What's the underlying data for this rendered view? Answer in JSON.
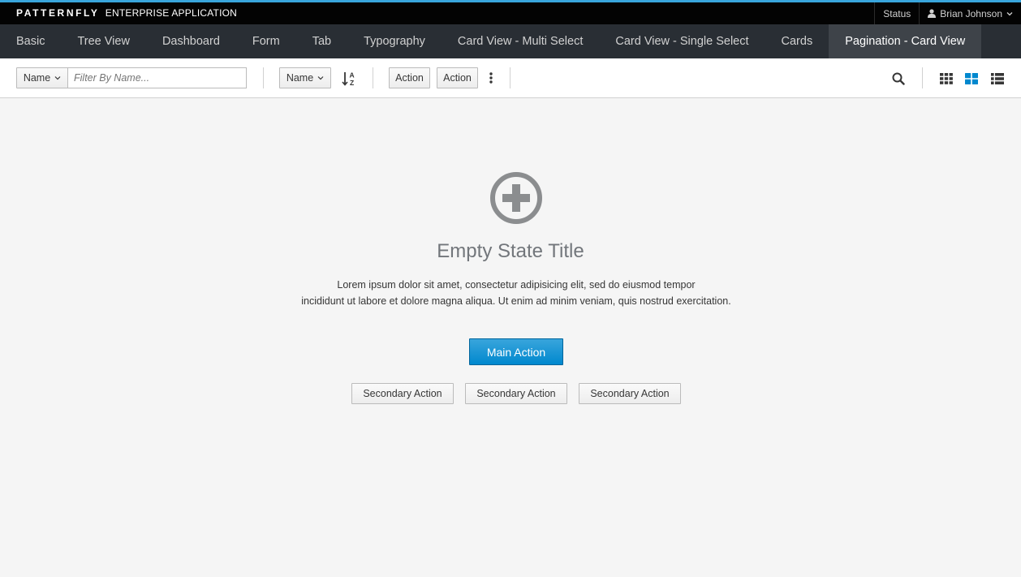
{
  "masthead": {
    "brand_logo": "PATTERNFLY",
    "brand_app": "ENTERPRISE APPLICATION",
    "status_label": "Status",
    "user_name": "Brian Johnson"
  },
  "nav": {
    "items": [
      {
        "label": "Basic"
      },
      {
        "label": "Tree View"
      },
      {
        "label": "Dashboard"
      },
      {
        "label": "Form"
      },
      {
        "label": "Tab"
      },
      {
        "label": "Typography"
      },
      {
        "label": "Card View - Multi Select"
      },
      {
        "label": "Card View - Single Select"
      },
      {
        "label": "Cards"
      },
      {
        "label": "Pagination - Card View"
      }
    ],
    "active": "Pagination - Card View"
  },
  "toolbar": {
    "filter_field": "Name",
    "filter_placeholder": "Filter By Name...",
    "sort_field": "Name",
    "sort_icon": "sort-alpha-asc-icon",
    "action1_label": "Action",
    "action2_label": "Action",
    "kebab_icon": "kebab-icon",
    "search_icon": "search-icon",
    "views": [
      "card-view-icon",
      "small-card-view-icon",
      "list-view-icon"
    ],
    "active_view": "small-card-view-icon"
  },
  "empty_state": {
    "icon": "add-circle-icon",
    "title": "Empty State Title",
    "text_line1": "Lorem ipsum dolor sit amet, consectetur adipisicing elit, sed do eiusmod tempor",
    "text_line2": "incididunt ut labore et dolore magna aliqua. Ut enim ad minim veniam, quis nostrud exercitation.",
    "main_action": "Main Action",
    "secondary_actions": [
      "Secondary Action",
      "Secondary Action",
      "Secondary Action"
    ]
  },
  "colors": {
    "accent": "#0088ce",
    "active_view": "#0088ce",
    "masthead": "#030303",
    "nav": "#292e34",
    "background": "#f5f5f5"
  }
}
